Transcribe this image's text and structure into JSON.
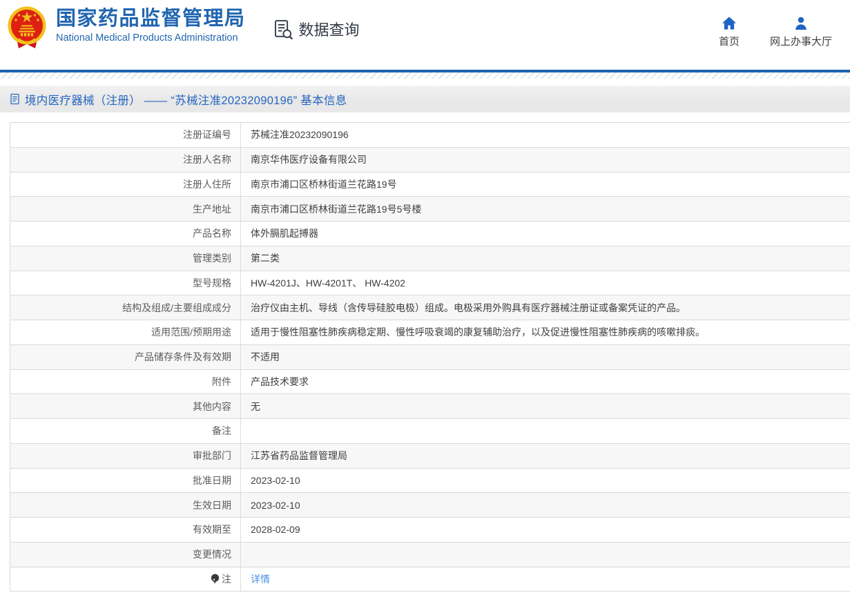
{
  "header": {
    "brand": {
      "title": "国家药品监督管理局",
      "subtitle": "National Medical Products Administration"
    },
    "section_label": "数据查询",
    "nav": [
      {
        "label": "首页"
      },
      {
        "label": "网上办事大厅"
      }
    ]
  },
  "page": {
    "title": "境内医疗器械（注册） —— “苏械注准20232090196” 基本信息"
  },
  "table": {
    "rows": [
      {
        "label": "注册证编号",
        "value": "苏械注准20232090196"
      },
      {
        "label": "注册人名称",
        "value": "南京华伟医疗设备有限公司"
      },
      {
        "label": "注册人住所",
        "value": "南京市浦口区桥林街道兰花路19号"
      },
      {
        "label": "生产地址",
        "value": "南京市浦口区桥林街道兰花路19号5号楼"
      },
      {
        "label": "产品名称",
        "value": "体外膈肌起搏器"
      },
      {
        "label": "管理类别",
        "value": "第二类"
      },
      {
        "label": "型号规格",
        "value": "HW-4201J、HW-4201T、 HW-4202"
      },
      {
        "label": "结构及组成/主要组成成分",
        "value": "治疗仪由主机、导线（含传导硅胶电极）组成。电极采用外购具有医疗器械注册证或备案凭证的产品。"
      },
      {
        "label": "适用范围/预期用途",
        "value": "适用于慢性阻塞性肺疾病稳定期、慢性呼吸衰竭的康复辅助治疗，以及促进慢性阻塞性肺疾病的咳嗽排痰。"
      },
      {
        "label": "产品储存条件及有效期",
        "value": "不适用"
      },
      {
        "label": "附件",
        "value": "产品技术要求"
      },
      {
        "label": "其他内容",
        "value": "无"
      },
      {
        "label": "备注",
        "value": ""
      },
      {
        "label": "审批部门",
        "value": "江苏省药品监督管理局"
      },
      {
        "label": "批准日期",
        "value": "2023-02-10"
      },
      {
        "label": "生效日期",
        "value": "2023-02-10"
      },
      {
        "label": "有效期至",
        "value": "2028-02-09"
      },
      {
        "label": "变更情况",
        "value": ""
      },
      {
        "label": "注",
        "value": "详情",
        "label_icon": "bulb-icon",
        "value_link": true
      }
    ]
  },
  "colors": {
    "brand_blue": "#2065b0",
    "nav_icon_blue": "#1f63c5",
    "divider_blue": "#1c64ae",
    "title_blue": "#2667c0",
    "link_blue": "#4a90e2",
    "row_alt_gray": "#f7f7f7",
    "border_gray": "#d9d9d9"
  }
}
